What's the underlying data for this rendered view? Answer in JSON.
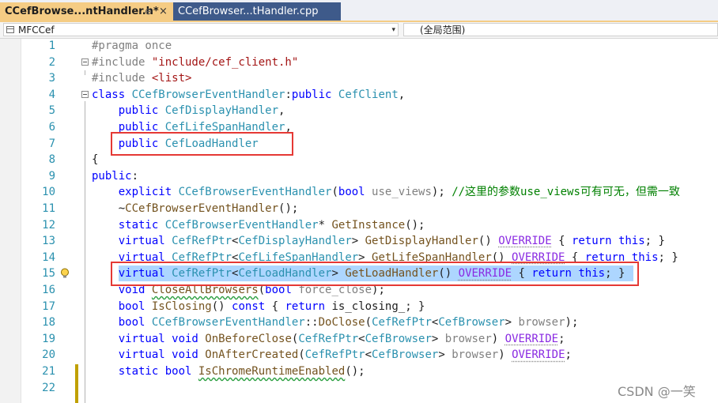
{
  "tabs": {
    "active_label": "CCefBrowse...ntHandler.h*",
    "pin_glyph": "⊕",
    "close_glyph": "×",
    "inactive_label": "CCefBrowser...tHandler.cpp"
  },
  "navbar": {
    "project": "MFCCef",
    "scope": "(全局范围)",
    "arrow_glyph": "▾"
  },
  "line_numbers": [
    "1",
    "2",
    "3",
    "4",
    "5",
    "6",
    "7",
    "8",
    "9",
    "10",
    "11",
    "12",
    "13",
    "14",
    "15",
    "16",
    "17",
    "18",
    "19",
    "20",
    "21",
    "22"
  ],
  "lines": [
    [
      [
        "pp",
        "#pragma once"
      ]
    ],
    [
      [
        "pp",
        "#include "
      ],
      [
        "str",
        "\"include/cef_client.h\""
      ]
    ],
    [
      [
        "pp",
        "#include "
      ],
      [
        "str",
        "<list>"
      ]
    ],
    [
      [
        "kw",
        "class "
      ],
      [
        "ty",
        "CCefBrowserEventHandler"
      ],
      [
        "tx",
        ":"
      ],
      [
        "kw",
        "public "
      ],
      [
        "ty",
        "CefClient"
      ],
      [
        "tx",
        ","
      ]
    ],
    [
      [
        "tx",
        "    "
      ],
      [
        "kw",
        "public "
      ],
      [
        "ty",
        "CefDisplayHandler"
      ],
      [
        "tx",
        ","
      ]
    ],
    [
      [
        "tx",
        "    "
      ],
      [
        "kw",
        "public "
      ],
      [
        "ty",
        "CefLifeSpanHandler"
      ],
      [
        "tx",
        ","
      ]
    ],
    [
      [
        "tx",
        "    "
      ],
      [
        "kw",
        "public "
      ],
      [
        "ty",
        "CefLoadHandler"
      ]
    ],
    [
      [
        "tx",
        "{"
      ]
    ],
    [
      [
        "kw",
        "public"
      ],
      [
        "tx",
        ":"
      ]
    ],
    [
      [
        "tx",
        "    "
      ],
      [
        "kw",
        "explicit "
      ],
      [
        "ty",
        "CCefBrowserEventHandler"
      ],
      [
        "tx",
        "("
      ],
      [
        "kw",
        "bool "
      ],
      [
        "prm",
        "use_views"
      ],
      [
        "tx",
        "); "
      ],
      [
        "cm",
        "//这里的参数use_views可有可无，但需一致"
      ]
    ],
    [
      [
        "tx",
        "    ~"
      ],
      [
        "fn",
        "CCefBrowserEventHandler"
      ],
      [
        "tx",
        "();"
      ]
    ],
    [
      [
        "tx",
        "    "
      ],
      [
        "kw",
        "static "
      ],
      [
        "ty",
        "CCefBrowserEventHandler"
      ],
      [
        "tx",
        "* "
      ],
      [
        "fn",
        "GetInstance"
      ],
      [
        "tx",
        "();"
      ]
    ],
    [
      [
        "tx",
        "    "
      ],
      [
        "kw",
        "virtual "
      ],
      [
        "ty",
        "CefRefPtr"
      ],
      [
        "tx",
        "<"
      ],
      [
        "ty",
        "CefDisplayHandler"
      ],
      [
        "tx",
        "> "
      ],
      [
        "fn",
        "GetDisplayHandler"
      ],
      [
        "tx",
        "() "
      ],
      [
        "mac",
        "OVERRIDE"
      ],
      [
        "tx",
        " { "
      ],
      [
        "kw",
        "return this"
      ],
      [
        "tx",
        "; }"
      ]
    ],
    [
      [
        "tx",
        "    "
      ],
      [
        "kw",
        "virtual "
      ],
      [
        "ty",
        "CefRefPtr"
      ],
      [
        "tx",
        "<"
      ],
      [
        "ty",
        "CefLifeSpanHandler"
      ],
      [
        "tx",
        "> "
      ],
      [
        "fn",
        "GetLifeSpanHandler"
      ],
      [
        "tx",
        "() "
      ],
      [
        "mac",
        "OVERRIDE"
      ],
      [
        "tx",
        " { "
      ],
      [
        "kw",
        "return this"
      ],
      [
        "tx",
        "; }"
      ]
    ],
    [
      [
        "tx",
        "    "
      ],
      [
        "kw",
        "virtual "
      ],
      [
        "ty",
        "CefRefPtr"
      ],
      [
        "tx",
        "<"
      ],
      [
        "ty",
        "CefLoadHandler"
      ],
      [
        "tx",
        "> "
      ],
      [
        "fn",
        "GetLoadHandler"
      ],
      [
        "tx",
        "() "
      ],
      [
        "mac",
        "OVERRIDE"
      ],
      [
        "tx",
        " { "
      ],
      [
        "kw",
        "return this"
      ],
      [
        "tx",
        "; }"
      ]
    ],
    [
      [
        "tx",
        "    "
      ],
      [
        "kw",
        "void "
      ],
      [
        "fn",
        "CloseAllBrowsers"
      ],
      [
        "tx",
        "("
      ],
      [
        "kw",
        "bool "
      ],
      [
        "prm",
        "force_close"
      ],
      [
        "tx",
        ");"
      ]
    ],
    [
      [
        "tx",
        "    "
      ],
      [
        "kw",
        "bool "
      ],
      [
        "fn",
        "IsClosing"
      ],
      [
        "tx",
        "() "
      ],
      [
        "kw",
        "const "
      ],
      [
        "tx",
        "{ "
      ],
      [
        "kw",
        "return "
      ],
      [
        "tx",
        "is_closing_; }"
      ]
    ],
    [
      [
        "tx",
        "    "
      ],
      [
        "kw",
        "bool "
      ],
      [
        "ty",
        "CCefBrowserEventHandler"
      ],
      [
        "tx",
        "::"
      ],
      [
        "fn",
        "DoClose"
      ],
      [
        "tx",
        "("
      ],
      [
        "ty",
        "CefRefPtr"
      ],
      [
        "tx",
        "<"
      ],
      [
        "ty",
        "CefBrowser"
      ],
      [
        "tx",
        "> "
      ],
      [
        "prm",
        "browser"
      ],
      [
        "tx",
        ");"
      ]
    ],
    [
      [
        "tx",
        "    "
      ],
      [
        "kw",
        "virtual void "
      ],
      [
        "fn",
        "OnBeforeClose"
      ],
      [
        "tx",
        "("
      ],
      [
        "ty",
        "CefRefPtr"
      ],
      [
        "tx",
        "<"
      ],
      [
        "ty",
        "CefBrowser"
      ],
      [
        "tx",
        "> "
      ],
      [
        "prm",
        "browser"
      ],
      [
        "tx",
        ") "
      ],
      [
        "mac",
        "OVERRIDE"
      ],
      [
        "tx",
        ";"
      ]
    ],
    [
      [
        "tx",
        "    "
      ],
      [
        "kw",
        "virtual void "
      ],
      [
        "fn",
        "OnAfterCreated"
      ],
      [
        "tx",
        "("
      ],
      [
        "ty",
        "CefRefPtr"
      ],
      [
        "tx",
        "<"
      ],
      [
        "ty",
        "CefBrowser"
      ],
      [
        "tx",
        "> "
      ],
      [
        "prm",
        "browser"
      ],
      [
        "tx",
        ") "
      ],
      [
        "mac",
        "OVERRIDE"
      ],
      [
        "tx",
        ";"
      ]
    ],
    [
      [
        "tx",
        "    "
      ],
      [
        "kw",
        "static bool "
      ],
      [
        "fn",
        "IsChromeRuntimeEnabled"
      ],
      [
        "tx",
        "();"
      ]
    ],
    [
      [
        "tx",
        ""
      ]
    ]
  ],
  "selected_line": 15,
  "lightbulb_line": 15,
  "watermark": "CSDN @一笑",
  "colors": {
    "keyword": "#0000ff",
    "type": "#2b91af",
    "string": "#a31515",
    "preprocessor": "#808080",
    "comment": "#008000",
    "macro": "#8a2be2",
    "function": "#74531f",
    "selection": "#add6ff",
    "highlight_box": "#e53935",
    "active_tab": "#f5cc84",
    "inactive_tab": "#3e5a8a"
  }
}
